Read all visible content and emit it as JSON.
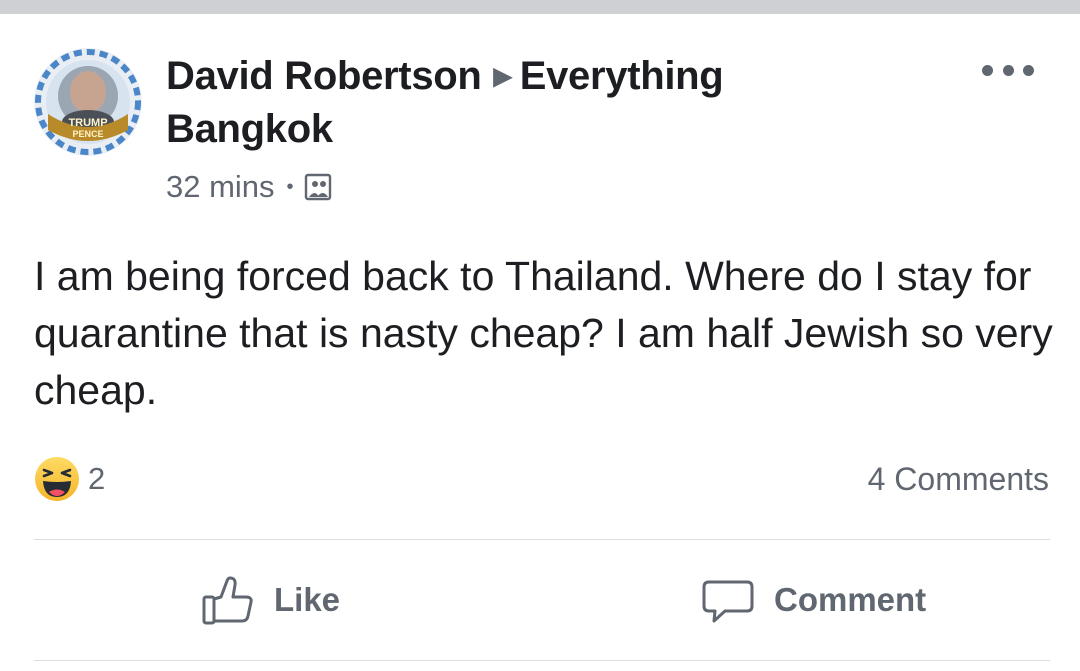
{
  "post": {
    "author": "David Robertson",
    "group": "Everything Bangkok",
    "time": "32 mins",
    "separator": "•",
    "privacy_icon": "photo-album-icon",
    "avatar_badge_line1": "TRUMP",
    "avatar_badge_line2": "PENCE",
    "text": "I am being forced back to Thailand. Where do I stay for quarantine that is nasty cheap? I am half Jewish so very cheap.",
    "reaction_icon": "haha-emoji-icon",
    "reaction_count": "2",
    "comments_label": "4 Comments"
  },
  "actions": {
    "like_label": "Like",
    "comment_label": "Comment"
  },
  "colors": {
    "text": "#1c1e21",
    "secondary": "#606770",
    "divider": "#dadde1",
    "top_bar": "#ced0d4"
  }
}
